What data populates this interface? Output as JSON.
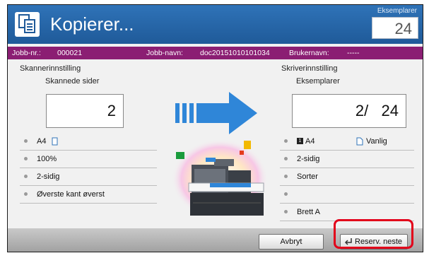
{
  "header": {
    "title": "Kopierer...",
    "copies_label": "Eksemplarer",
    "copies_value": "24"
  },
  "jobbar": {
    "job_no_label": "Jobb-nr.:",
    "job_no": "000021",
    "job_name_label": "Jobb-navn:",
    "job_name": "doc20151010101034",
    "user_label": "Brukernavn:",
    "user": "-----"
  },
  "scan": {
    "section_title": "Skannerinnstilling",
    "sub_title": "Skannede sider",
    "value": "2",
    "rows": [
      "A4",
      "100%",
      "2-sidig",
      "Øverste kant øverst"
    ]
  },
  "print": {
    "section_title": "Skriverinnstilling",
    "sub_title": "Eksemplarer",
    "value": "2/   24",
    "rows": [
      "A4",
      "2-sidig",
      "Sorter",
      "",
      "Brett A"
    ],
    "paper_type": "Vanlig"
  },
  "footer": {
    "cancel_label": "Avbryt",
    "reserve_label": "Reserv. neste"
  },
  "colors": {
    "header_blue": "#2a6db3",
    "job_bar": "#8b1e73",
    "arrow_blue": "#2f86d8",
    "highlight": "#e2001a"
  }
}
